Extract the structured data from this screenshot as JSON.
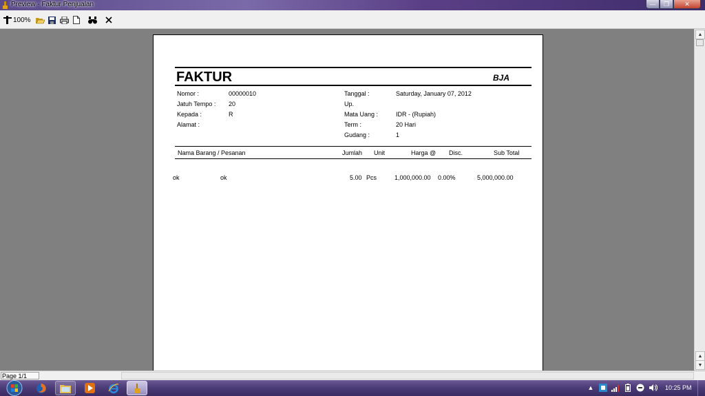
{
  "window": {
    "title": "Preview - Faktur Penjualan"
  },
  "toolbar": {
    "zoom_label": "100%"
  },
  "document": {
    "title": "FAKTUR",
    "company": "BJA",
    "left_fields": [
      {
        "label": "Nomor :",
        "value": "00000010"
      },
      {
        "label": "Jatuh Tempo :",
        "value": "20"
      },
      {
        "label": "Kepada :",
        "value": "R"
      },
      {
        "label": "Alamat :",
        "value": ""
      }
    ],
    "right_fields": [
      {
        "label": "Tanggal :",
        "value": "Saturday, January 07, 2012"
      },
      {
        "label": "Up.",
        "value": ""
      },
      {
        "label": "Mata Uang :",
        "value": "IDR - (Rupiah)"
      },
      {
        "label": "Term :",
        "value": "20 Hari"
      },
      {
        "label": "Gudang :",
        "value": "1"
      }
    ],
    "columns": {
      "item": "Nama Barang / Pesanan",
      "qty": "Jumlah",
      "unit": "Unit",
      "price": "Harga @",
      "disc": "Disc.",
      "subtotal": "Sub Total"
    },
    "rows": [
      {
        "code": "ok",
        "name": "ok",
        "qty": "5.00",
        "unit": "Pcs",
        "price": "1,000,000.00",
        "disc": "0.00%",
        "subtotal": "5,000,000.00"
      }
    ]
  },
  "status": {
    "page_indicator": "Page 1/1"
  },
  "taskbar": {
    "clock": "10:25 PM"
  },
  "colors": {
    "taskbar": "#4c3c78",
    "preview_bg": "#808080",
    "titlebar": "#5a4a8a"
  }
}
